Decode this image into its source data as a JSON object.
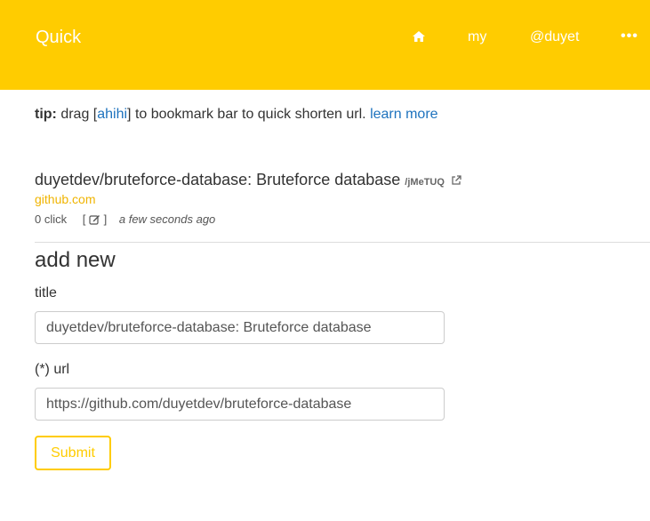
{
  "colors": {
    "brand": "#ffcc00",
    "link": "#1e73be",
    "domain_text": "#f0b400"
  },
  "navbar": {
    "brand": "Quick",
    "home_icon": "home-icon",
    "my": "my",
    "user": "@duyet",
    "more": "•••"
  },
  "tip": {
    "label": "tip:",
    "text1": " drag [",
    "bookmarklet": "ahihi",
    "text2": "] to bookmark bar to quick shorten url. ",
    "learn_more": "learn more"
  },
  "entry": {
    "title": "duyetdev/bruteforce-database: Bruteforce database",
    "shortcode": "/jMeTUQ",
    "external_icon": "external-link-icon",
    "domain": "github.com",
    "clicks": "0 click",
    "edit_open": "[",
    "edit_icon": "edit-icon",
    "edit_close": "]",
    "time": "a few seconds ago"
  },
  "form": {
    "heading": "add new",
    "title_label": "title",
    "title_value": "duyetdev/bruteforce-database: Bruteforce database",
    "url_label": "(*) url",
    "url_value": "https://github.com/duyetdev/bruteforce-database",
    "submit": "Submit"
  }
}
